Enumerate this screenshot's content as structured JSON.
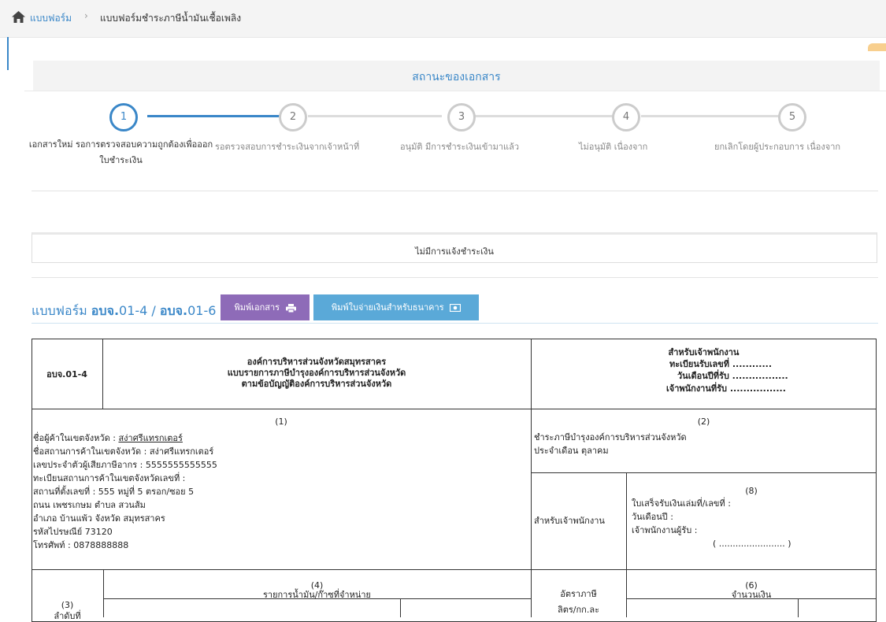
{
  "breadcrumb": {
    "home_link": "แบบฟอร์ม",
    "separator": "›",
    "current": "แบบฟอร์มชำระภาษีน้ำมันเชื้อเพลิง"
  },
  "status": {
    "title": "สถานะของเอกสาร",
    "steps": [
      {
        "number": "1",
        "label": "เอกสารใหม่ รอการตรวจสอบความถูกต้องเพื่อออกใบชำระเงิน",
        "active": true
      },
      {
        "number": "2",
        "label": "รอตรวจสอบการชำระเงินจากเจ้าหน้าที่",
        "active": false
      },
      {
        "number": "3",
        "label": "อนุมัติ มีการชำระเงินเข้ามาแล้ว",
        "active": false
      },
      {
        "number": "4",
        "label": "ไม่อนุมัติ เนื่องจาก",
        "active": false
      },
      {
        "number": "5",
        "label": "ยกเลิกโดยผู้ประกอบการ เนื่องจาก",
        "active": false
      }
    ]
  },
  "payment_notice": "ไม่มีการแจ้งชำระเงิน",
  "form": {
    "title_prefix": "แบบฟอร์ม",
    "title_code1": "อบจ.",
    "title_num1": "01-4",
    "title_slash": " / ",
    "title_code2": "อบจ.",
    "title_num2": "01-6",
    "print_button": "พิมพ์เอกสาร",
    "bank_button": "พิมพ์ใบจ่ายเงินสำหรับธนาคาร"
  },
  "doc": {
    "code": "อบจ.01-4",
    "header_lines": [
      "องค์การบริหารส่วนจังหวัดสมุทรสาคร",
      "แบบรายการภาษีบำรุงองค์การบริหารส่วนจังหวัด",
      "ตามข้อบัญญัติองค์การบริหารส่วนจังหวัด"
    ],
    "officer_lines": [
      "สำหรับเจ้าพนักงาน",
      "ทะเบียนรับเลขที่ ............",
      "วันเดือนปีที่รับ .................",
      "เจ้าพนักงานที่รับ ................."
    ],
    "sec1_num": "(1)",
    "sec1_name_label": "ชื่อผู้ค้าในเขตจังหวัด : ",
    "sec1_name_value": "สง่าศรีแทรกเตอร์",
    "sec1_lines": [
      "ชื่อสถานการค้าในเขตจังหวัด : สง่าศรีแทรกเตอร์",
      "เลขประจำตัวผู้เสียภาษีอากร : 5555555555555",
      "ทะเบียนสถานการค้าในเขตจังหวัดเลขที่ :",
      "สถานที่ตั้งเลขที่ : 555 หมู่ที่ 5 ตรอก/ซอย 5",
      "ถนน เพชรเกษม ตำบล สวนส้ม",
      "อำเภอ บ้านแพ้ว จังหวัด สมุทรสาคร",
      "รหัสไปรษณีย์ 73120",
      "โทรศัพท์ : 0878888888"
    ],
    "sec2_num": "(2)",
    "sec2_lines": [
      "ชำระภาษีบำรุงองค์การบริหารส่วนจังหวัด",
      "ประจำเดือน ตุลาคม"
    ],
    "officer_label": "สำหรับเจ้าพนักงาน",
    "sec8_num": "(8)",
    "sec8_lines": [
      "ใบเสร็จรับเงินเล่มที่/เลขที่ :",
      "วันเดือนปี :",
      "เจ้าพนักงานผู้รับ :",
      "( ........................ )"
    ],
    "sec3_num": "(3)",
    "sec3_label": "ลำดับที่",
    "sec4_num": "(4)",
    "sec4_label": "รายการน้ำมัน/ก๊าซที่จำหน่าย",
    "sec5_lines": [
      "อัตราภาษี",
      "ลิตร/กก.ละ"
    ],
    "sec6_num": "(6)",
    "sec6_label": "จำนวนเงิน"
  }
}
